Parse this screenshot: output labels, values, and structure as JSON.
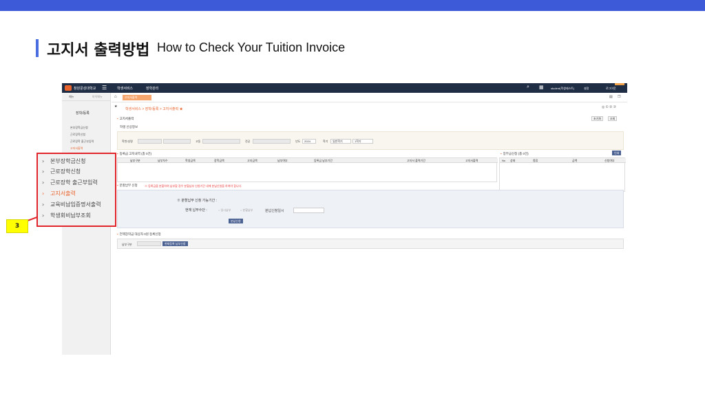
{
  "slide": {
    "title_ko": "고지서 출력방법",
    "title_en": "How to Check Your Tuition Invoice"
  },
  "colors": {
    "top_band": "#3d5bd9",
    "accent": "#e9632c",
    "highlight_border": "#e0242a",
    "badge": "#ffff00"
  },
  "app": {
    "header": {
      "school_name": "창원문성대학교",
      "menu": [
        "학생서비스",
        "장학관리"
      ],
      "user": "student(학생테스트)",
      "settings": "설정",
      "logout": "로그아웃"
    },
    "sidebar": {
      "tabs": [
        "메뉴",
        "마이메뉴"
      ],
      "title": "장학/등록",
      "items": [
        {
          "label": "본부장학금신청",
          "active": false
        },
        {
          "label": "근로장학신청",
          "active": false
        },
        {
          "label": "근로장학 출근부입력",
          "active": false
        },
        {
          "label": "고지서출력",
          "active": true
        }
      ]
    },
    "tab_label": "고지서출력",
    "breadcrumb": "학생서비스 > 장학/등록 > 고지서출력 ★",
    "page_heading": "고지서출력",
    "buttons": {
      "reset": "초기화",
      "search": "조회",
      "print": "인쇄",
      "split_apply": "분납신청",
      "grad_pay_apply": "현재등록 납부신청"
    },
    "filter": {
      "section_label": "학생 신상정보",
      "student_label": "학번/성명",
      "grade_label": "고동",
      "major_label": "전공",
      "year_label": "년도",
      "year_value": "2024",
      "term_label": "학기",
      "term_value": "일반학기",
      "term2_value": "1학기"
    },
    "main_table": {
      "title": "등록금 고지내역",
      "count": "(총 0건)",
      "columns": [
        "납부구분",
        "납부차수",
        "학생금액",
        "장학금액",
        "고지금액",
        "납부여부",
        "등록금 납부기간",
        "고지서 출력기간",
        "고지서출력"
      ]
    },
    "side_table": {
      "title": "장부금신청",
      "count": "(총 0건)",
      "columns": [
        "No",
        "상태",
        "종류",
        "금액",
        "신청여부"
      ]
    },
    "split": {
      "title": "분할납부 신청",
      "notice": "※ 등록금을 분할하여 납부할 경우 분할납부 신청기간 내에 분납신청을 하여야 합니다.",
      "period_label": "※ 분할납부 신청 가능기간 :",
      "method_label": "현재 납부수단 :",
      "radio1": "일시납부",
      "radio2": "분할납부",
      "date_label": "분납신청일시"
    },
    "graduate": {
      "title": "전액장학금 대상자 0원 등록신청",
      "pay_label": "납부구분"
    }
  },
  "annotation": {
    "step": "3",
    "items": [
      {
        "label": "본부장학금신청",
        "active": false
      },
      {
        "label": "근로장학신청",
        "active": false
      },
      {
        "label": "근로장학 출근부입력",
        "active": false
      },
      {
        "label": "고지서출력",
        "active": true
      },
      {
        "label": "교육비납입증명서출력",
        "active": false
      },
      {
        "label": "학생회비납부조회",
        "active": false
      }
    ]
  }
}
